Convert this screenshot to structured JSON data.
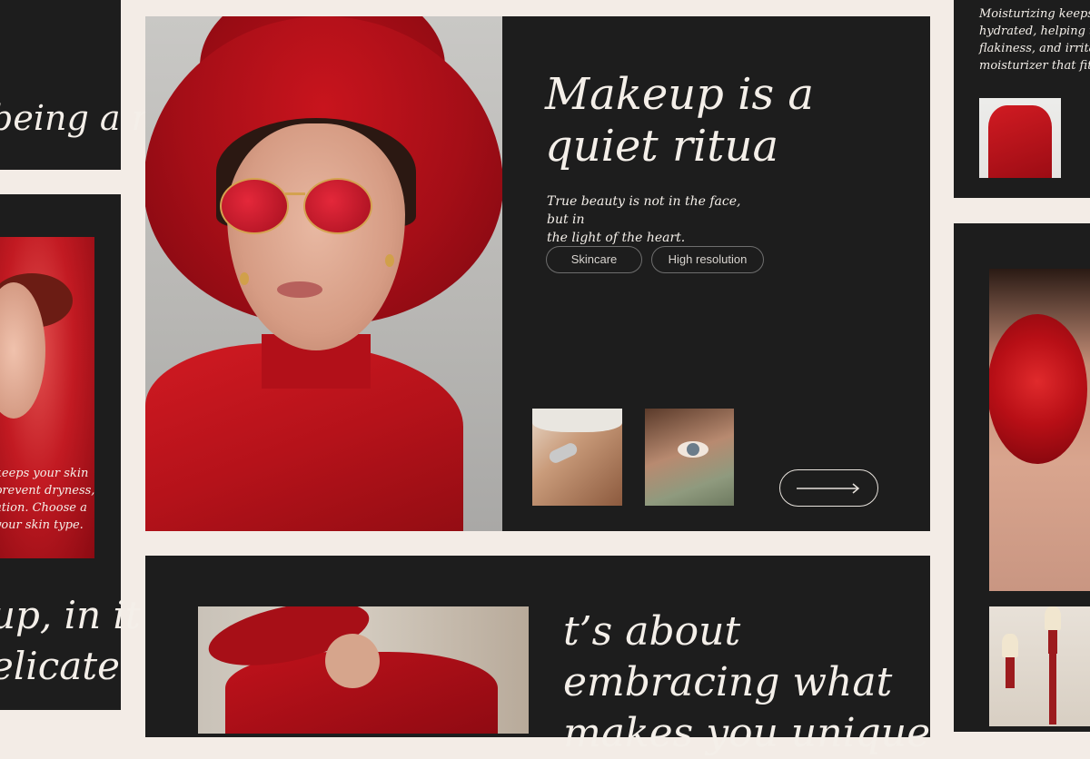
{
  "hero": {
    "headline_line1": "Makeup is a",
    "headline_line2": "quiet ritua",
    "quote_line1": "True beauty is not in the face, but in",
    "quote_line2": "the light of the heart.",
    "tags": [
      "Skincare",
      "High resolution"
    ],
    "next_icon": "long-arrow-right-icon"
  },
  "left_top": {
    "text": "being a r"
  },
  "left_mid": {
    "caption_lines": [
      "keeps your skin",
      "prevent dryness,",
      "ation. Choose a",
      "your skin type."
    ],
    "big_lines": [
      "up, in it",
      "elicate"
    ]
  },
  "right_top": {
    "caption_lines": [
      "Moisturizing keeps yo",
      "hydrated, helping to p",
      "flakiness, and irritati",
      "moisturizer that fits y"
    ]
  },
  "bottom": {
    "headline_lines": [
      "t’s about",
      "embracing what",
      "makes you unique"
    ]
  },
  "colors": {
    "background": "#f3ece6",
    "card": "#1d1d1d",
    "accent_red": "#c0121b",
    "text_light": "#f4efe9"
  }
}
